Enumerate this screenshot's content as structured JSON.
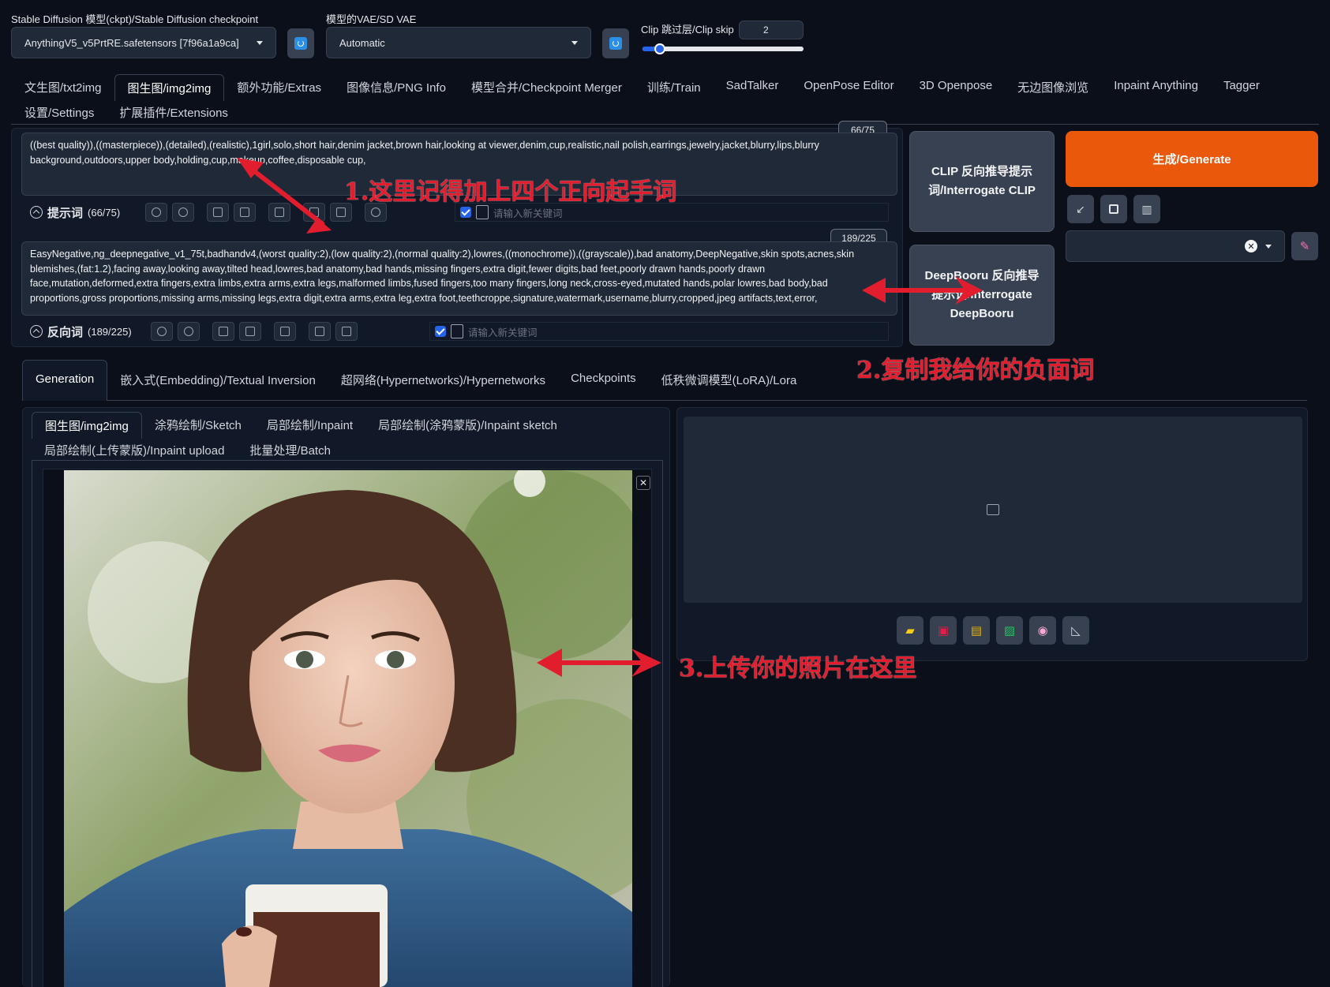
{
  "settings": {
    "checkpoint_label": "Stable Diffusion 模型(ckpt)/Stable Diffusion checkpoint",
    "checkpoint_value": "AnythingV5_v5PrtRE.safetensors [7f96a1a9ca]",
    "vae_label": "模型的VAE/SD VAE",
    "vae_value": "Automatic",
    "clip_skip_label": "Clip 跳过层/Clip skip",
    "clip_skip_value": "2",
    "clip_skip_fraction": 0.11
  },
  "main_tabs": [
    "文生图/txt2img",
    "图生图/img2img",
    "额外功能/Extras",
    "图像信息/PNG Info",
    "模型合并/Checkpoint Merger",
    "训练/Train",
    "SadTalker",
    "OpenPose Editor",
    "3D Openpose",
    "无边图像浏览",
    "Inpaint Anything",
    "Tagger",
    "设置/Settings",
    "扩展插件/Extensions"
  ],
  "prompt": {
    "counter": "66/75",
    "text": "((best quality)),((masterpiece)),(detailed),(realistic),1girl,solo,short hair,denim jacket,brown hair,looking at viewer,denim,cup,realistic,nail polish,earrings,jewelry,jacket,blurry,lips,blurry background,outdoors,upper body,holding,cup,makeup,coffee,disposable cup,",
    "label": "提示词",
    "count": "(66/75)",
    "keyword_placeholder": "请输入新关键词"
  },
  "negative": {
    "counter": "189/225",
    "text": "EasyNegative,ng_deepnegative_v1_75t,badhandv4,(worst quality:2),(low quality:2),(normal quality:2),lowres,((monochrome)),((grayscale)),bad anatomy,DeepNegative,skin spots,acnes,skin blemishes,(fat:1.2),facing away,looking away,tilted head,lowres,bad anatomy,bad hands,missing fingers,extra digit,fewer digits,bad feet,poorly drawn hands,poorly drawn face,mutation,deformed,extra fingers,extra limbs,extra arms,extra legs,malformed limbs,fused fingers,too many fingers,long neck,cross-eyed,mutated hands,polar lowres,bad body,bad proportions,gross proportions,missing arms,missing legs,extra digit,extra arms,extra leg,extra foot,teethcroppe,signature,watermark,username,blurry,cropped,jpeg artifacts,text,error,",
    "label": "反向词",
    "count": "(189/225)",
    "keyword_placeholder": "请输入新关键词"
  },
  "buttons": {
    "interrogate_clip": "CLIP 反向推导提示词/Interrogate CLIP",
    "interrogate_deepbooru": "DeepBooru 反向推导提示词/Interrogate DeepBooru",
    "generate": "生成/Generate"
  },
  "sub_tabs": [
    "Generation",
    "嵌入式(Embedding)/Textual Inversion",
    "超网络(Hypernetworks)/Hypernetworks",
    "Checkpoints",
    "低秩微调模型(LoRA)/Lora"
  ],
  "mode_tabs": [
    "图生图/img2img",
    "涂鸦绘制/Sketch",
    "局部绘制/Inpaint",
    "局部绘制(涂鸦蒙版)/Inpaint sketch",
    "局部绘制(上传蒙版)/Inpaint upload",
    "批量处理/Batch"
  ],
  "output_icons": [
    "folder-icon",
    "save-icon",
    "zip-icon",
    "image-icon",
    "palette-icon",
    "ruler-icon"
  ],
  "annotations": {
    "a1": "1.这里记得加上四个正向起手词",
    "a2": "2.复制我给你的负面词",
    "a3": "3.上传你的照片在这里"
  },
  "colors": {
    "background": "#0b0f19",
    "accent": "#ea580c",
    "annotation": "#e11d2e"
  }
}
